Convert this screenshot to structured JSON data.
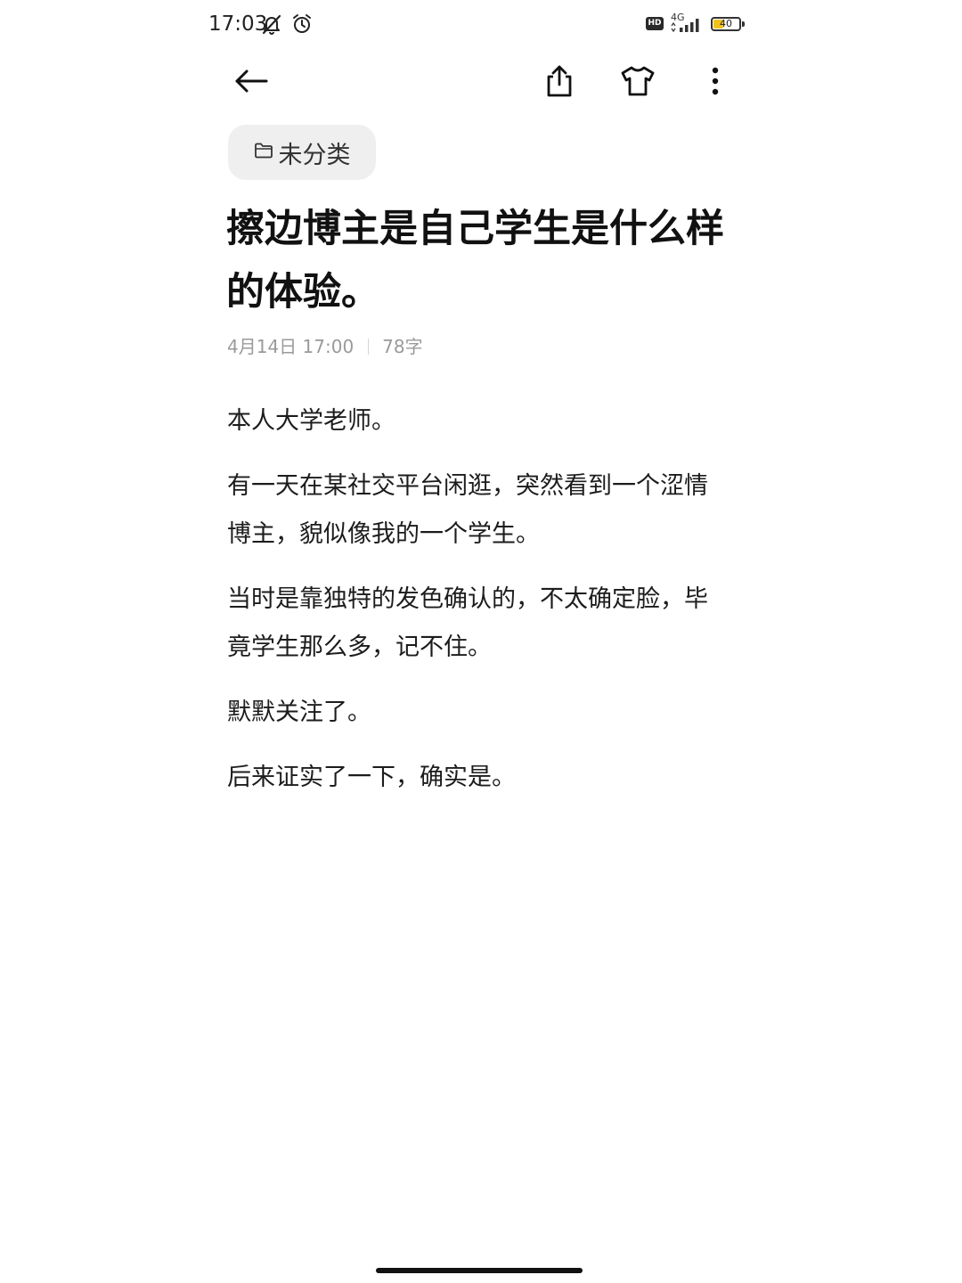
{
  "status_bar": {
    "time": "17:03",
    "hd_label": "HD",
    "network_label": "4G",
    "battery_level": "40",
    "battery_fraction": 0.4,
    "icons": [
      "mute-icon",
      "alarm-icon",
      "signal-icon",
      "battery-icon"
    ]
  },
  "toolbar": {
    "icons": [
      "back-arrow-icon",
      "share-icon",
      "tshirt-theme-icon",
      "more-vertical-icon"
    ]
  },
  "folder": {
    "label": "未分类",
    "icon": "folder-icon"
  },
  "note": {
    "title": "擦边博主是自己学生是什么样的体验。",
    "date": "4月14日 17:00",
    "word_count": "78字",
    "paragraphs": [
      "本人大学老师。",
      "有一天在某社交平台闲逛，突然看到一个涩情博主，貌似像我的一个学生。",
      "当时是靠独特的发色确认的，不太确定脸，毕竟学生那么多，记不住。",
      "默默关注了。",
      "后来证实了一下，确实是。"
    ]
  },
  "colors": {
    "background": "#ffffff",
    "text": "#1c1c1c",
    "meta_text": "#9a9a9a",
    "chip_background": "#efefef",
    "battery_fill": "#f2c21b"
  }
}
